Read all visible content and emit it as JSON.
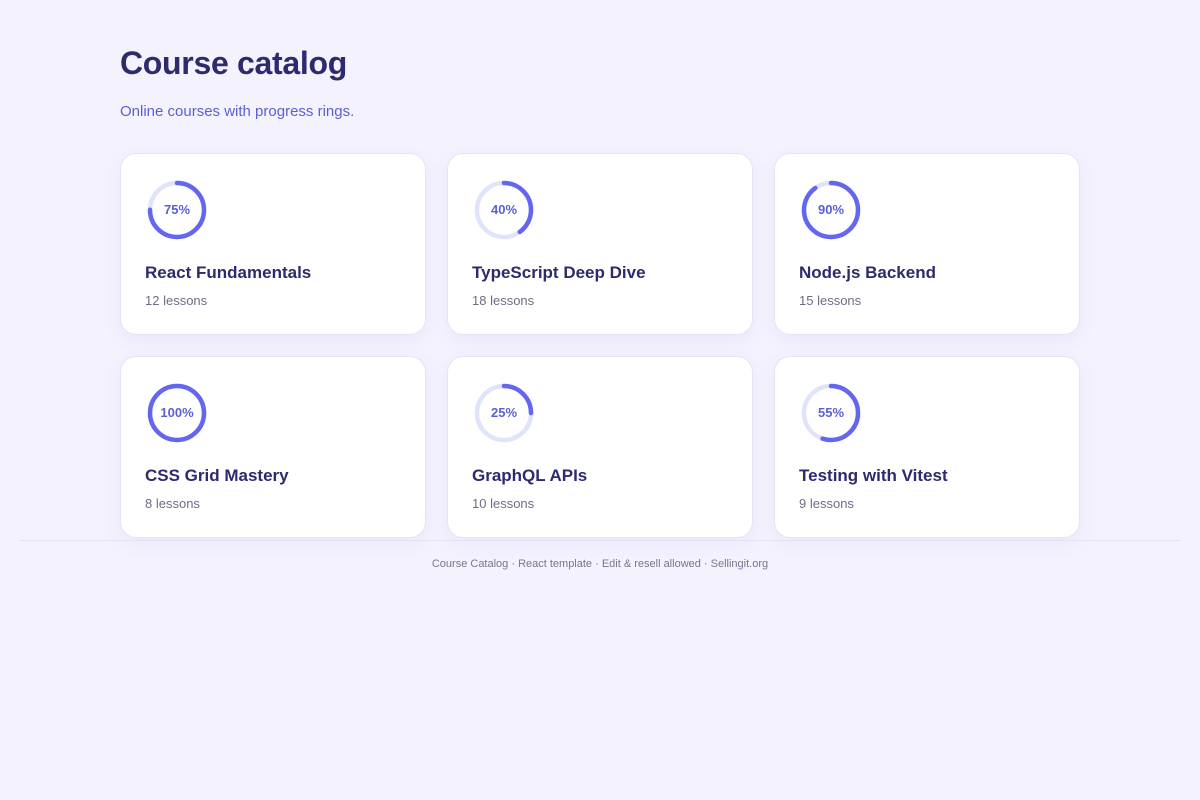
{
  "header": {
    "title": "Course catalog",
    "subtitle": "Online courses with progress rings."
  },
  "colors": {
    "accent": "#6366f1",
    "ring_track": "#e0e4fb",
    "title": "#2d2a6e",
    "subtitle": "#5b5fd6",
    "background": "#f4f2fd"
  },
  "courses": [
    {
      "title": "React Fundamentals",
      "lessons": "12 lessons",
      "progress": 75,
      "progress_label": "75%"
    },
    {
      "title": "TypeScript Deep Dive",
      "lessons": "18 lessons",
      "progress": 40,
      "progress_label": "40%"
    },
    {
      "title": "Node.js Backend",
      "lessons": "15 lessons",
      "progress": 90,
      "progress_label": "90%"
    },
    {
      "title": "CSS Grid Mastery",
      "lessons": "8 lessons",
      "progress": 100,
      "progress_label": "100%"
    },
    {
      "title": "GraphQL APIs",
      "lessons": "10 lessons",
      "progress": 25,
      "progress_label": "25%"
    },
    {
      "title": "Testing with Vitest",
      "lessons": "9 lessons",
      "progress": 55,
      "progress_label": "55%"
    }
  ],
  "footer": {
    "text": "Course Catalog · React template · Edit & resell allowed · Sellingit.org"
  }
}
